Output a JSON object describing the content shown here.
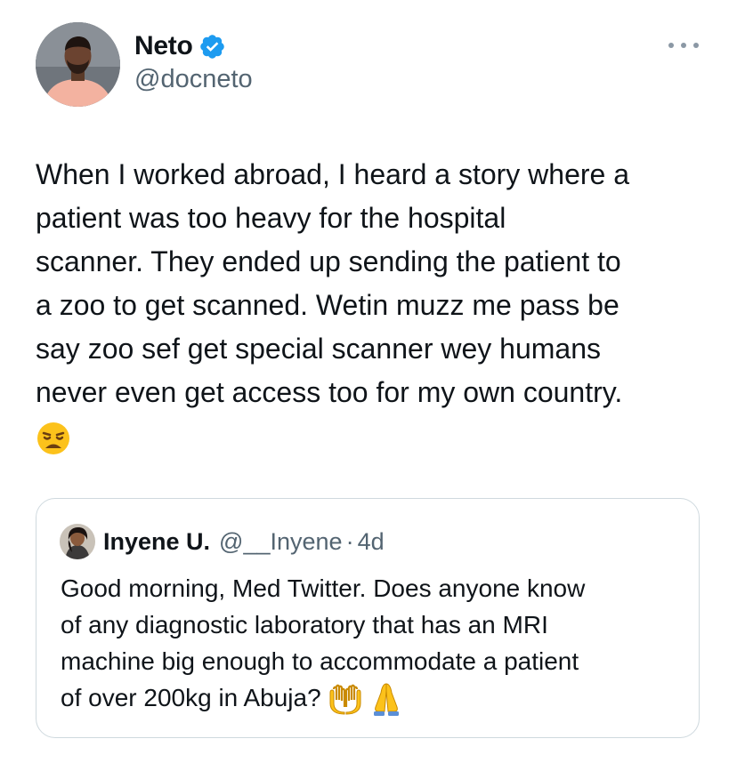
{
  "tweet": {
    "author": {
      "display_name": "Neto",
      "handle": "@docneto",
      "verified": true,
      "avatar_icon": "profile-photo-man-pink-shirt"
    },
    "more_icon": "ellipsis-icon",
    "text_lines": [
      "When I worked abroad, I heard a story where a",
      "patient was too heavy for the hospital",
      "scanner. They ended up sending the patient to",
      "a zoo to get scanned. Wetin muzz me pass be",
      "say zoo sef get special scanner wey humans",
      "never even get access too for my own country."
    ],
    "emoji": "😩"
  },
  "quote": {
    "author": {
      "display_name": "Inyene U.",
      "handle": "@__Inyene",
      "separator": "·",
      "time": "4d",
      "avatar_icon": "profile-photo-woman"
    },
    "text_lines": [
      "Good morning, Med Twitter. Does anyone know",
      "of any diagnostic laboratory that has an MRI",
      "machine big enough to accommodate a patient",
      "of over 200kg in Abuja?"
    ],
    "emojis": [
      "🤲",
      "🙏"
    ]
  },
  "colors": {
    "text_primary": "#0f1419",
    "text_secondary": "#536471",
    "verified_blue": "#1d9bf0",
    "card_border": "#cfd9de"
  }
}
